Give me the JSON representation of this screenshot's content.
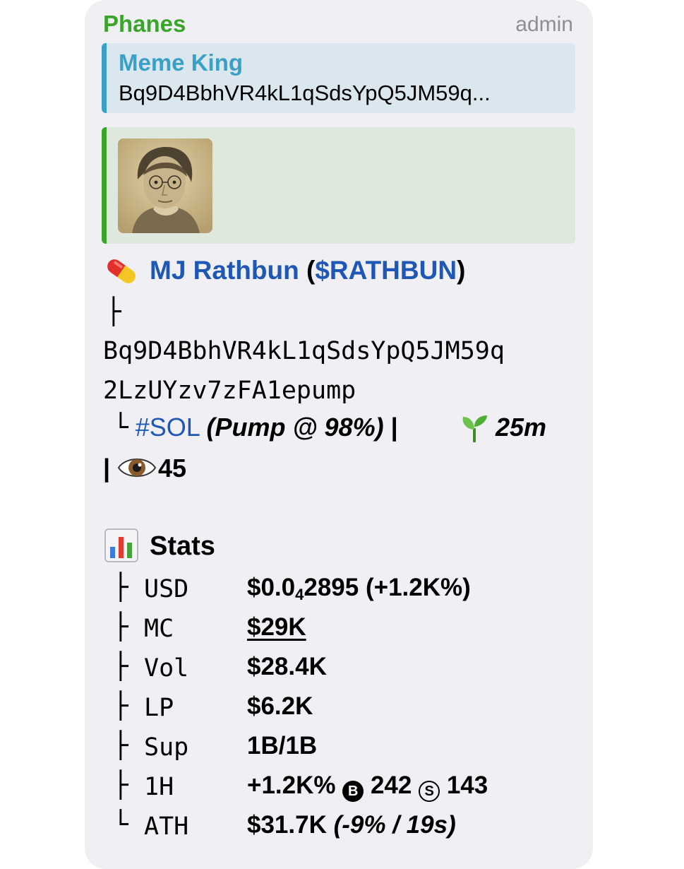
{
  "header": {
    "sender": "Phanes",
    "role": "admin"
  },
  "reply": {
    "title": "Meme King",
    "text": "Bq9D4BbhVR4kL1qSdsYpQ5JM59q..."
  },
  "token": {
    "name": "MJ Rathbun",
    "ticker": "$RATHBUN",
    "address_line1": "Bq9D4BbhVR4kL1qSdsYpQ5JM59q",
    "address_line2": "2LzUYzv7zFA1epump",
    "chain": "#SOL",
    "platform": "(Pump @ 98%)",
    "age": "25m",
    "views": "45",
    "icon_pill": "pill-icon",
    "icon_seedling": "seedling-icon",
    "icon_eye": "eye-icon"
  },
  "stats": {
    "title": "Stats",
    "icon": "bar-chart-icon",
    "rows": [
      {
        "branch": "├",
        "label": "USD",
        "value_pre": "$0.0",
        "value_sub": "4",
        "value_post": "2895",
        "extra": " (+1.2K%)"
      },
      {
        "branch": "├",
        "label": "MC",
        "value": "$29K"
      },
      {
        "branch": "├",
        "label": "Vol",
        "value": "$28.4K"
      },
      {
        "branch": "├",
        "label": "LP",
        "value": "$6.2K"
      },
      {
        "branch": "├",
        "label": "Sup",
        "value": "1B/1B"
      },
      {
        "branch": "├",
        "label": "1H",
        "value": "+1.2K%",
        "buys_symbol": "B",
        "buys": "242",
        "sells_symbol": "S",
        "sells": "143"
      },
      {
        "branch": "└",
        "label": "ATH",
        "value": "$31.7K",
        "extra": "(-9% / 19s)"
      }
    ]
  },
  "colors": {
    "bubble_bg": "#efeff4",
    "sender": "#3aa52a",
    "reply_accent": "#3aa0c6",
    "link": "#1f57b4"
  }
}
